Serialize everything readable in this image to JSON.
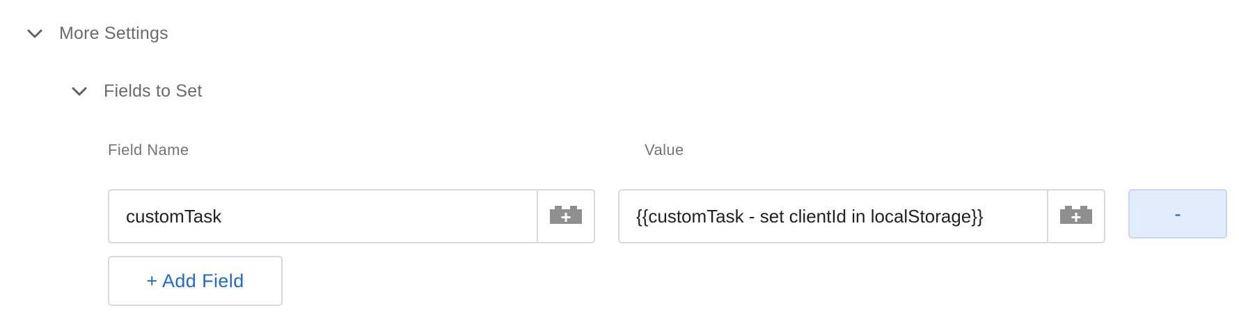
{
  "more_settings": {
    "title": "More Settings",
    "icon": "chevron-down-icon",
    "expanded": true
  },
  "fields_to_set": {
    "title": "Fields to Set",
    "icon": "chevron-down-icon",
    "expanded": true,
    "columns": {
      "field_name": "Field Name",
      "value": "Value"
    },
    "rows": [
      {
        "field_name": "customTask",
        "value": "{{customTask - set clientId in localStorage}}",
        "variable_icon": "variable-picker-icon",
        "remove_label": "-"
      }
    ],
    "add_field_label": "+ Add Field"
  },
  "colors": {
    "accent": "#1a6ad3",
    "remove_button_bg": "#e3ecfb",
    "border": "#dadada",
    "heading_text": "#6b6b6b"
  }
}
